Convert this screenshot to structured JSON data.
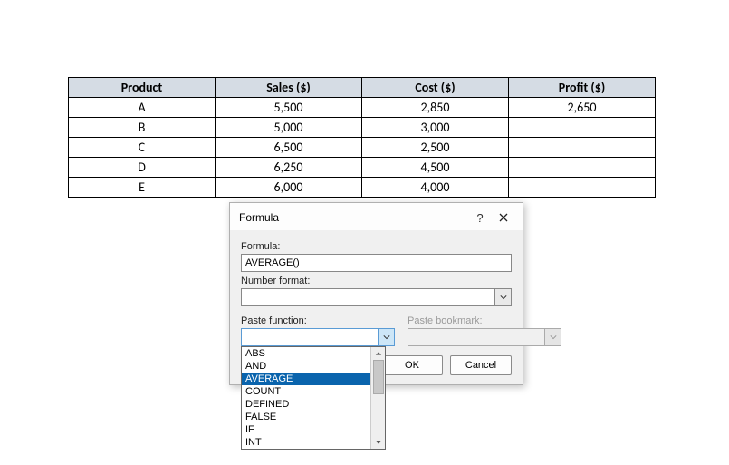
{
  "table": {
    "headers": [
      "Product",
      "Sales ($)",
      "Cost ($)",
      "Profit ($)"
    ],
    "rows": [
      {
        "product": "A",
        "sales": "5,500",
        "cost": "2,850",
        "profit": "2,650"
      },
      {
        "product": "B",
        "sales": "5,000",
        "cost": "3,000",
        "profit": ""
      },
      {
        "product": "C",
        "sales": "6,500",
        "cost": "2,500",
        "profit": ""
      },
      {
        "product": "D",
        "sales": "6,250",
        "cost": "4,500",
        "profit": ""
      },
      {
        "product": "E",
        "sales": "6,000",
        "cost": "4,000",
        "profit": ""
      }
    ]
  },
  "dialog": {
    "title": "Formula",
    "formula_label": "Formula:",
    "formula_value": "AVERAGE()",
    "numfmt_label": "Number format:",
    "numfmt_value": "",
    "pastefn_label": "Paste function:",
    "pastefn_value": "",
    "pastebm_label": "Paste bookmark:",
    "pastebm_value": "",
    "ok_label": "OK",
    "cancel_label": "Cancel",
    "dropdown_items": [
      "ABS",
      "AND",
      "AVERAGE",
      "COUNT",
      "DEFINED",
      "FALSE",
      "IF",
      "INT"
    ],
    "dropdown_selected_index": 2
  }
}
